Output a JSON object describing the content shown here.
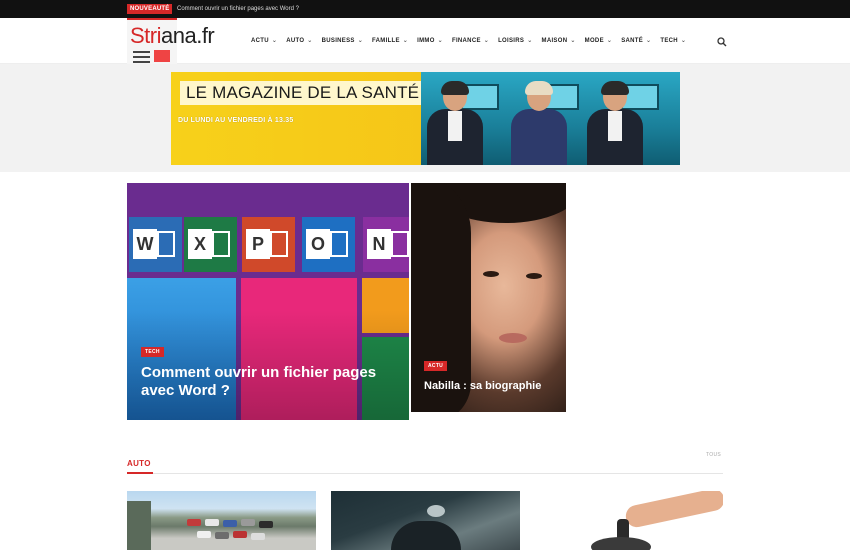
{
  "topbar": {
    "badge": "NOUVEAUTÉ",
    "headline": "Comment ouvrir un fichier pages avec Word ?"
  },
  "header": {
    "logo_part1": "Stri",
    "logo_part2": "ana.fr",
    "nav": [
      {
        "label": "ACTU"
      },
      {
        "label": "AUTO"
      },
      {
        "label": "BUSINESS"
      },
      {
        "label": "FAMILLE"
      },
      {
        "label": "IMMO"
      },
      {
        "label": "FINANCE"
      },
      {
        "label": "LOISIRS"
      },
      {
        "label": "MAISON"
      },
      {
        "label": "MODE"
      },
      {
        "label": "SANTÉ"
      },
      {
        "label": "TECH"
      }
    ]
  },
  "banner": {
    "title": "LE MAGAZINE DE LA SANTÉ",
    "subtitle": "DU LUNDI AU VENDREDI À 13.35"
  },
  "featured": {
    "main": {
      "category": "TECH",
      "title": "Comment ouvrir un fichier pages avec Word ?",
      "tiles": [
        "W",
        "X",
        "P",
        "O",
        "N"
      ]
    },
    "side": {
      "category": "ACTU",
      "title": "Nabilla : sa biographie"
    }
  },
  "section": {
    "title": "AUTO",
    "all_link": "TOUS"
  },
  "colors": {
    "accent": "#d62828",
    "topbar": "#111111",
    "banner_yellow": "#f5c518"
  }
}
